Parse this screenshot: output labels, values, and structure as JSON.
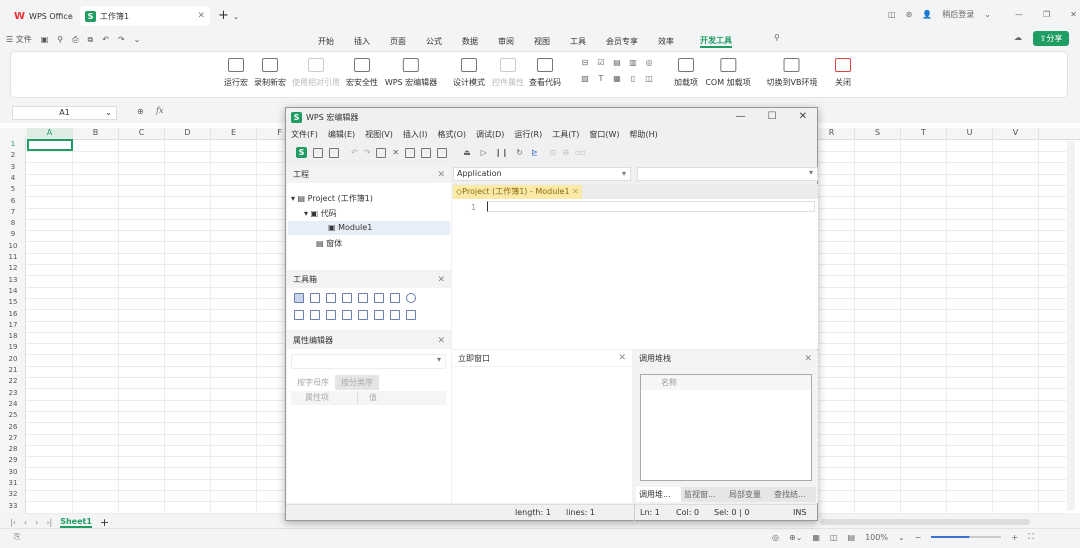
{
  "titlebar": {
    "app_tab": "WPS Office",
    "doc_tab": "工作簿1",
    "login": "稍后登录"
  },
  "quickbar": {
    "file": "文件"
  },
  "menu": [
    "开始",
    "插入",
    "页面",
    "公式",
    "数据",
    "审阅",
    "视图",
    "工具",
    "会员专享",
    "效率",
    "开发工具"
  ],
  "active_menu": "开发工具",
  "share": "分享",
  "ribbon": [
    {
      "label": "运行宏",
      "disabled": false
    },
    {
      "label": "录制新宏",
      "disabled": false
    },
    {
      "label": "使用相对引用",
      "disabled": true
    },
    {
      "label": "宏安全性",
      "disabled": false
    },
    {
      "label": "WPS 宏编辑器",
      "disabled": false
    },
    {
      "label": "设计模式",
      "disabled": false
    },
    {
      "label": "控件属性",
      "disabled": true
    },
    {
      "label": "查看代码",
      "disabled": false
    },
    {
      "label": "加载项",
      "disabled": false
    },
    {
      "label": "COM 加载项",
      "disabled": false
    },
    {
      "label": "切换到VB环境",
      "disabled": false
    },
    {
      "label": "关闭",
      "disabled": false
    }
  ],
  "formula_bar": {
    "cell_ref": "A1",
    "fx": "fx"
  },
  "columns": [
    "A",
    "B",
    "C",
    "D",
    "E",
    "F",
    "G",
    "H",
    "I",
    "J",
    "K",
    "L",
    "M",
    "N",
    "O",
    "P",
    "Q",
    "R",
    "S",
    "T",
    "U",
    "V"
  ],
  "rows": [
    "1",
    "2",
    "3",
    "4",
    "5",
    "6",
    "7",
    "8",
    "9",
    "10",
    "11",
    "12",
    "13",
    "14",
    "15",
    "16",
    "17",
    "18",
    "19",
    "20",
    "21",
    "22",
    "23",
    "24",
    "25",
    "26",
    "27",
    "28",
    "29",
    "30",
    "31",
    "32",
    "33"
  ],
  "sheet_tab": "Sheet1",
  "statusbar": {
    "zoom": "100%"
  },
  "editor": {
    "title": "WPS 宏编辑器",
    "menus": [
      "文件(F)",
      "编辑(E)",
      "视图(V)",
      "插入(I)",
      "格式(O)",
      "调试(D)",
      "运行(R)",
      "工具(T)",
      "窗口(W)",
      "帮助(H)"
    ],
    "project_pane": {
      "title": "工程",
      "root": "Project (工作簿1)",
      "code_folder": "代码",
      "module": "Module1",
      "forms": "窗体"
    },
    "toolbox_title": "工具箱",
    "props": {
      "title": "属性编辑器",
      "tab_alpha": "按字母序",
      "tab_cat": "按分类序",
      "col_prop": "属性项",
      "col_val": "值"
    },
    "object_combo": "Application",
    "code_tab": "Project (工作簿1) - Module1",
    "line_number": "1",
    "immediate_title": "立即窗口",
    "callstack": {
      "title": "调用堆栈",
      "col_name": "名称",
      "tabs": [
        "调用堆...",
        "监视窗...",
        "局部变量",
        "查找结..."
      ]
    },
    "status": {
      "length": "length: 1",
      "lines": "lines: 1",
      "ln": "Ln: 1",
      "col": "Col: 0",
      "sel": "Sel: 0 | 0",
      "mode": "INS"
    }
  },
  "colors": {
    "accent": "#1f9d62",
    "active_cell": "#1f9d62",
    "code_tab_bg": "#fbe9a8"
  }
}
